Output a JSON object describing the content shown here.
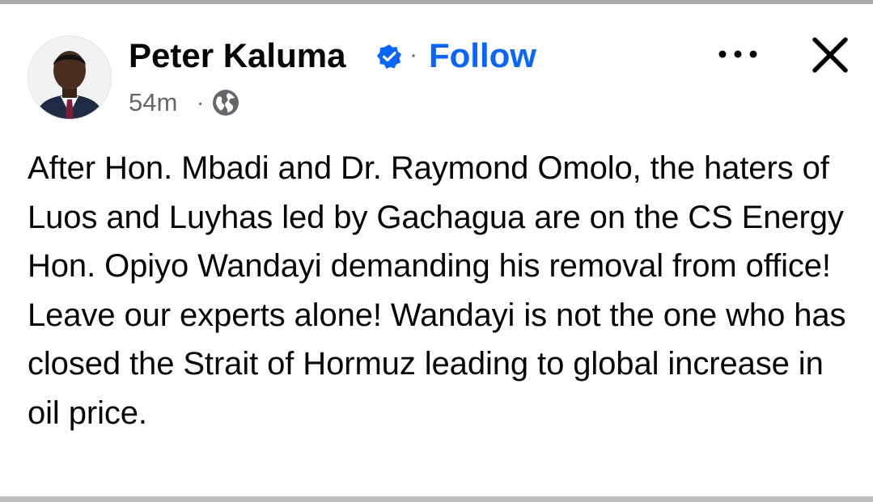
{
  "post": {
    "author_name": "Peter Kaluma",
    "separator": "·",
    "follow_label": "Follow",
    "timestamp": "54m",
    "meta_separator": "·",
    "audience_icon": "globe-icon",
    "body_text": "After Hon. Mbadi and Dr. Raymond Omolo, the haters of Luos and Luyhas led by Gachagua are on the CS Energy Hon. Opiyo Wandayi demanding his removal from office!\nLeave our experts alone! Wandayi is not the one who has closed the Strait of Hormuz leading to global increase in oil price."
  },
  "icons": {
    "verified": "verified-badge-icon",
    "more": "more-options-icon",
    "close": "close-icon"
  },
  "colors": {
    "follow": "#0866ff",
    "verified": "#0866ff",
    "secondary_text": "#65676b",
    "primary_text": "#050505"
  }
}
